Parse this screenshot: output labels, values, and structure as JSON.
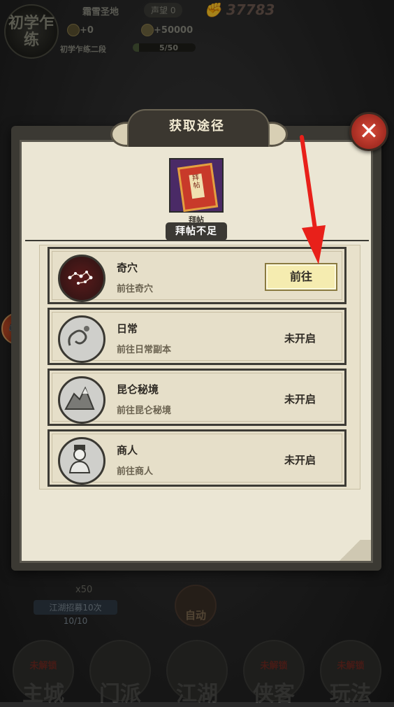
{
  "hud": {
    "rank_badge": "初学乍练",
    "location": "霜雪圣地",
    "reputation_label": "声望",
    "reputation_value": "0",
    "power_value": "37783",
    "currency1": "0",
    "currency2": "50000",
    "rank_name": "初学乍练二段",
    "exp_text": "5/50",
    "exp_progress": 0.1
  },
  "dialog": {
    "title": "获取途径",
    "close_icon": "close-x-icon",
    "item": {
      "name": "拜帖",
      "book_label": "拜帖",
      "insufficient": "拜帖不足"
    },
    "routes": [
      {
        "title": "奇穴",
        "subtitle": "前往奇穴",
        "action": "前往",
        "available": true,
        "icon": "constellation-icon"
      },
      {
        "title": "日常",
        "subtitle": "前往日常副本",
        "action": "未开启",
        "available": false,
        "icon": "dragon-icon"
      },
      {
        "title": "昆仑秘境",
        "subtitle": "前往昆仑秘境",
        "action": "未开启",
        "available": false,
        "icon": "mountain-icon"
      },
      {
        "title": "商人",
        "subtitle": "前往商人",
        "action": "未开启",
        "available": false,
        "icon": "merchant-icon"
      }
    ]
  },
  "recruit": {
    "count": "x50",
    "label": "江湖招募10次",
    "progress": "10/10"
  },
  "auto_label": "自动",
  "nav": [
    {
      "locked": "未解锁",
      "label": "主城"
    },
    {
      "locked": "",
      "label": "门派"
    },
    {
      "locked": "",
      "label": "江湖"
    },
    {
      "locked": "未解锁",
      "label": "侠客"
    },
    {
      "locked": "未解锁",
      "label": "玩法"
    }
  ],
  "colors": {
    "annotation_arrow": "#e8201a",
    "go_button": "#f5ecb0",
    "close_button": "#d94a3a"
  }
}
